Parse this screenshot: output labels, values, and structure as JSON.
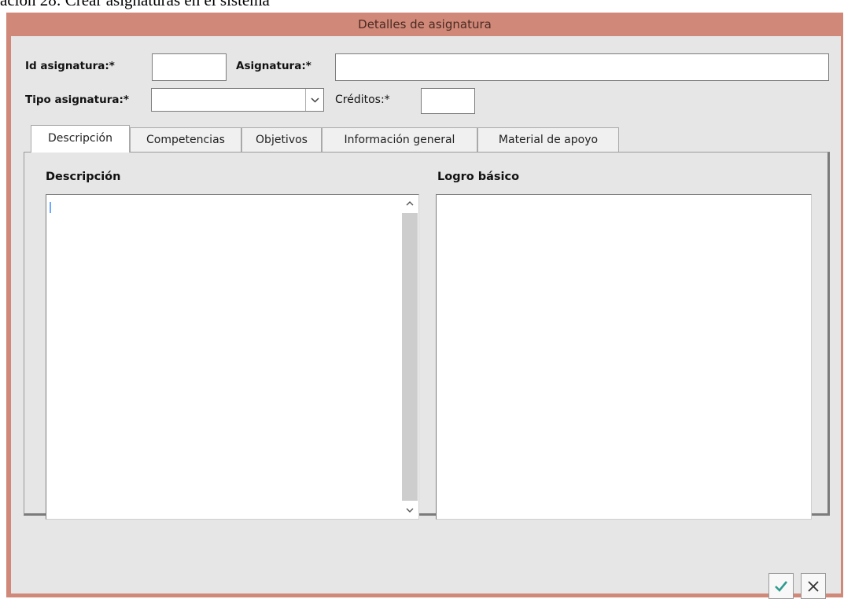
{
  "caption": "ación 28: Crear asignaturas en el sistema",
  "window": {
    "title": "Detalles de asignatura"
  },
  "form": {
    "id_label": "Id asignatura:*",
    "id_value": "",
    "asignatura_label": "Asignatura:*",
    "asignatura_value": "",
    "tipo_label": "Tipo asignatura:*",
    "tipo_value": "",
    "creditos_label": "Créditos:*",
    "creditos_value": ""
  },
  "tabs": [
    {
      "label": "Descripción",
      "active": true
    },
    {
      "label": "Competencias",
      "active": false
    },
    {
      "label": "Objetivos",
      "active": false
    },
    {
      "label": "Información general",
      "active": false
    },
    {
      "label": "Material de apoyo",
      "active": false
    }
  ],
  "panel": {
    "descripcion_label": "Descripción",
    "descripcion_value": "",
    "logro_label": "Logro básico",
    "logro_value": ""
  },
  "buttons": {
    "accept_icon": "check-icon",
    "cancel_icon": "close-icon"
  },
  "colors": {
    "titlebar": "#d08878",
    "client": "#e6e6e6",
    "accept": "#2e9b8e"
  }
}
